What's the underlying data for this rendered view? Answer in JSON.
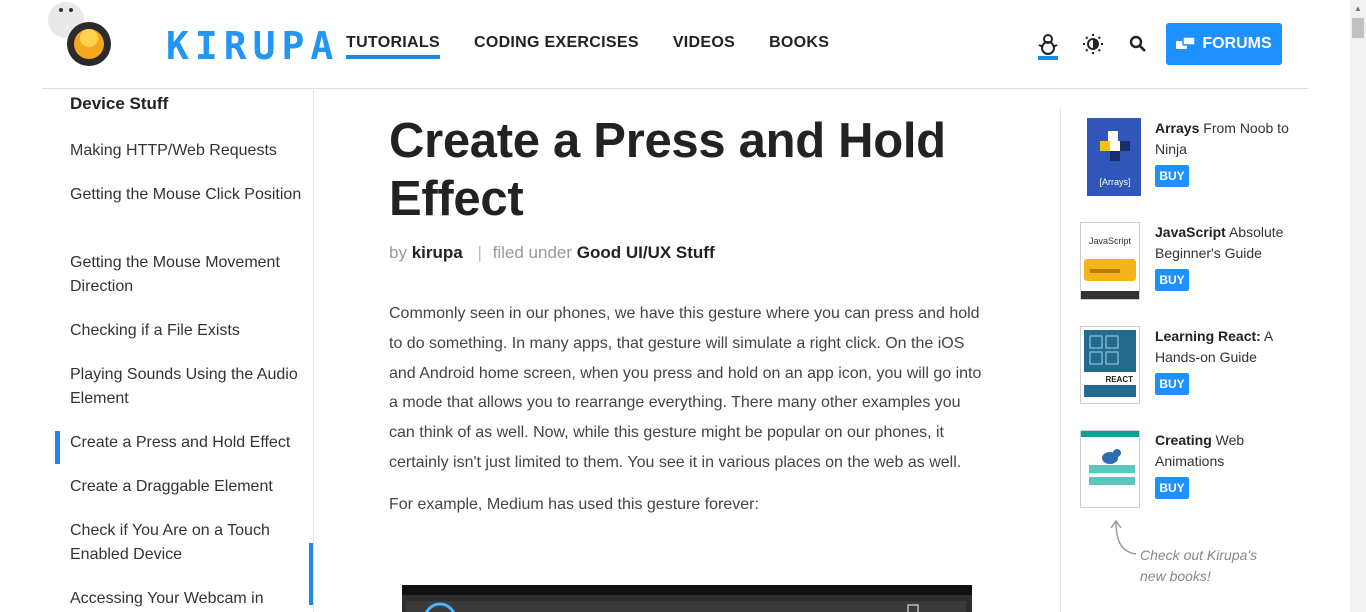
{
  "header": {
    "logo_text": "KIRUPA",
    "nav": [
      "TUTORIALS",
      "CODING EXERCISES",
      "VIDEOS",
      "BOOKS"
    ],
    "icons": [
      "snowman-icon",
      "brightness-icon",
      "search-icon"
    ],
    "forums_label": "FORUMS"
  },
  "sidebar": {
    "heading": "Device Stuff",
    "items": [
      "Making HTTP/Web Requests",
      "Getting the Mouse Click Position",
      "Getting the Mouse Movement Direction",
      "Checking if a File Exists",
      "Playing Sounds Using the Audio Element",
      "Create a Press and Hold Effect",
      "Create a Draggable Element",
      "Check if You Are on a Touch Enabled Device",
      "Accessing Your Webcam in"
    ],
    "active_item": "Create a Press and Hold Effect"
  },
  "article": {
    "title": "Create a Press and Hold Effect",
    "by_label": "by",
    "author": "kirupa",
    "filed_label": "filed under",
    "category": "Good UI/UX Stuff",
    "paragraph1": "Commonly seen in our phones, we have this gesture where you can press and hold to do something. In many apps, that gesture will simulate a right click. On the iOS and Android home screen, when you press and hold on an app icon, you will go into a mode that allows you to rearrange everything. There many other examples you can think of as well. Now, while this gesture might be popular on our phones, it certainly isn't just limited to them. You see it in various places on the web as well.",
    "paragraph2": "For example, Medium has used this gesture forever:"
  },
  "books": [
    {
      "title_bold": "Arrays",
      "title_rest": " From Noob to Ninja",
      "cover_text": "[Arrays]",
      "buy": "BUY"
    },
    {
      "title_bold": "JavaScript",
      "title_rest": " Absolute Beginner's Guide",
      "cover_text": "JavaScript",
      "buy": "BUY"
    },
    {
      "title_bold": "Learning React:",
      "title_rest": " A Hands-on Guide",
      "cover_text": "REACT",
      "buy": "BUY"
    },
    {
      "title_bold": "Creating",
      "title_rest": " Web Animations",
      "cover_text": "",
      "buy": "BUY"
    }
  ],
  "checkout_note": "Check out Kirupa's new books!",
  "colors": {
    "accent": "#1e88e5",
    "button": "#1e90ff"
  }
}
